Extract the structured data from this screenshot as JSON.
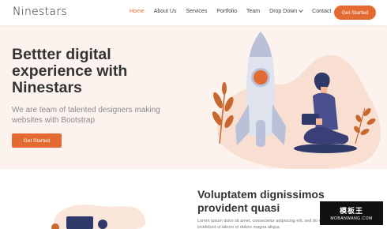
{
  "header": {
    "logo": "Ninestars",
    "nav": [
      "Home",
      "About Us",
      "Services",
      "Portfolio",
      "Team",
      "Drop Down",
      "Contact"
    ],
    "cta": "Get Started"
  },
  "hero": {
    "title": "Bettter digital experience with Ninestars",
    "subtitle": "We are team of talented designers making websites with Bootstrap",
    "button": "Get Started"
  },
  "about": {
    "title": "Voluptatem dignissimos provident quasi",
    "text": "Lorem ipsum dolor sit amet, consectetur adipiscing elit, sed do eiusmod tempor incididunt ut labore et dolore magna aliqua"
  },
  "watermark": {
    "main": "模板王",
    "sub": "MOBANWANG.COM"
  },
  "colors": {
    "accent": "#e36b32",
    "hero_bg": "#fcf3ee",
    "text_dark": "#333333"
  }
}
